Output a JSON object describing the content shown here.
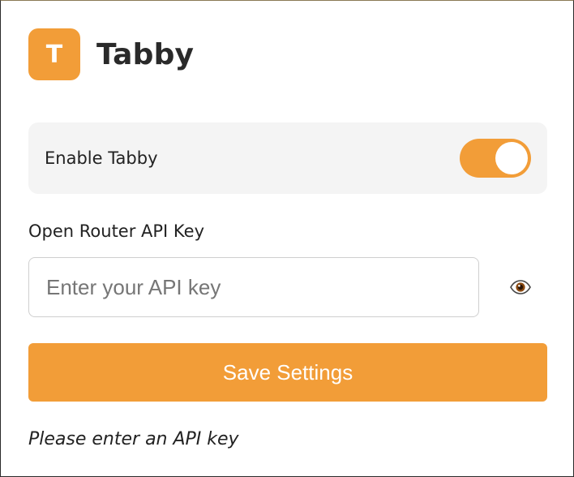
{
  "colors": {
    "accent": "#f29d38",
    "panel": "#f4f4f4",
    "input_border": "#cfcfcf"
  },
  "header": {
    "logo_letter": "T",
    "title": "Tabby"
  },
  "enable": {
    "label": "Enable Tabby",
    "toggle_on": true
  },
  "api_key": {
    "label": "Open Router API Key",
    "value": "",
    "placeholder": "Enter your API key",
    "visibility_icon": "eye-icon"
  },
  "actions": {
    "save_label": "Save Settings"
  },
  "status": {
    "message": "Please enter an API key"
  }
}
